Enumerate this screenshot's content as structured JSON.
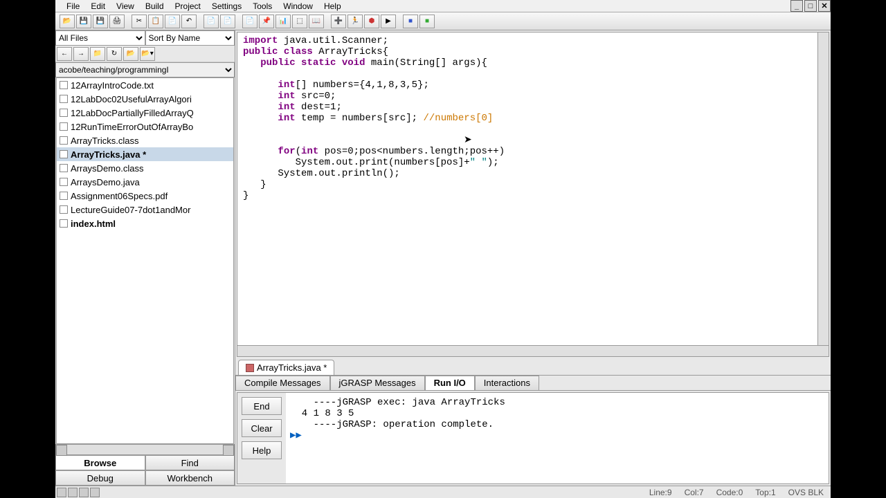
{
  "menu": [
    "File",
    "Edit",
    "View",
    "Build",
    "Project",
    "Settings",
    "Tools",
    "Window",
    "Help"
  ],
  "sidebar": {
    "filter": "All Files",
    "sort": "Sort By Name",
    "path": "acobe/teaching/programmingI",
    "files": [
      {
        "name": "12ArrayIntroCode.txt",
        "sel": false,
        "bold": false
      },
      {
        "name": "12LabDoc02UsefulArrayAlgori",
        "sel": false,
        "bold": false
      },
      {
        "name": "12LabDocPartiallyFilledArrayQ",
        "sel": false,
        "bold": false
      },
      {
        "name": "12RunTimeErrorOutOfArrayBo",
        "sel": false,
        "bold": false
      },
      {
        "name": "ArrayTricks.class",
        "sel": false,
        "bold": false
      },
      {
        "name": "ArrayTricks.java *",
        "sel": true,
        "bold": true
      },
      {
        "name": "ArraysDemo.class",
        "sel": false,
        "bold": false
      },
      {
        "name": "ArraysDemo.java",
        "sel": false,
        "bold": false
      },
      {
        "name": "Assignment06Specs.pdf",
        "sel": false,
        "bold": false
      },
      {
        "name": "LectureGuide07-7dot1andMor",
        "sel": false,
        "bold": false
      },
      {
        "name": "index.html",
        "sel": false,
        "bold": true
      }
    ],
    "tabs_row1": [
      "Browse",
      "Find"
    ],
    "tabs_row2": [
      "Debug",
      "Workbench"
    ],
    "active_tab": "Browse"
  },
  "editor": {
    "tab_label": "ArrayTricks.java *",
    "code_tokens": [
      [
        {
          "t": "import",
          "c": "kw"
        },
        {
          "t": " java.util.Scanner;"
        }
      ],
      [
        {
          "t": "public",
          "c": "kw"
        },
        {
          "t": " "
        },
        {
          "t": "class",
          "c": "kw"
        },
        {
          "t": " ArrayTricks{"
        }
      ],
      [
        {
          "t": "   "
        },
        {
          "t": "public",
          "c": "kw"
        },
        {
          "t": " "
        },
        {
          "t": "static",
          "c": "kw"
        },
        {
          "t": " "
        },
        {
          "t": "void",
          "c": "ty"
        },
        {
          "t": " main(String[] args){"
        }
      ],
      [
        {
          "t": ""
        }
      ],
      [
        {
          "t": "      "
        },
        {
          "t": "int",
          "c": "ty"
        },
        {
          "t": "[] numbers={4,1,8,3,5};"
        }
      ],
      [
        {
          "t": "      "
        },
        {
          "t": "int",
          "c": "ty"
        },
        {
          "t": " src=0;"
        }
      ],
      [
        {
          "t": "      "
        },
        {
          "t": "int",
          "c": "ty"
        },
        {
          "t": " dest=1;"
        }
      ],
      [
        {
          "t": "      "
        },
        {
          "t": "int",
          "c": "ty"
        },
        {
          "t": " temp = numbers[src]; "
        },
        {
          "t": "//numbers[0]",
          "c": "cm"
        }
      ],
      [
        {
          "t": "      "
        }
      ],
      [
        {
          "t": ""
        }
      ],
      [
        {
          "t": "      "
        },
        {
          "t": "for",
          "c": "kw"
        },
        {
          "t": "("
        },
        {
          "t": "int",
          "c": "ty"
        },
        {
          "t": " pos=0;pos<numbers.length;pos++)"
        }
      ],
      [
        {
          "t": "         System.out.print(numbers[pos]+"
        },
        {
          "t": "\" \"",
          "c": "st"
        },
        {
          "t": ");"
        }
      ],
      [
        {
          "t": "      System.out.println();"
        }
      ],
      [
        {
          "t": "   }"
        }
      ],
      [
        {
          "t": "}"
        }
      ]
    ]
  },
  "bottom": {
    "tabs": [
      "Compile Messages",
      "jGRASP Messages",
      "Run I/O",
      "Interactions"
    ],
    "active": "Run I/O",
    "buttons": [
      "End",
      "Clear",
      "Help"
    ],
    "output": [
      "    ----jGRASP exec: java ArrayTricks",
      "  4 1 8 3 5 ",
      "",
      "    ----jGRASP: operation complete."
    ],
    "prompt": "▶▶"
  },
  "status": {
    "line": "Line:9",
    "col": "Col:7",
    "code": "Code:0",
    "top": "Top:1",
    "mode": "OVS BLK"
  },
  "toolbar_icons": [
    "open",
    "save",
    "saveall",
    "print",
    "",
    "cut",
    "copy",
    "paste",
    "undo",
    "",
    "new",
    "newproj",
    "",
    "doc",
    "pin",
    "chart",
    "uml",
    "book",
    "",
    "plus",
    "run",
    "stop",
    "debug",
    "",
    "sq-blue",
    "sq-green"
  ]
}
